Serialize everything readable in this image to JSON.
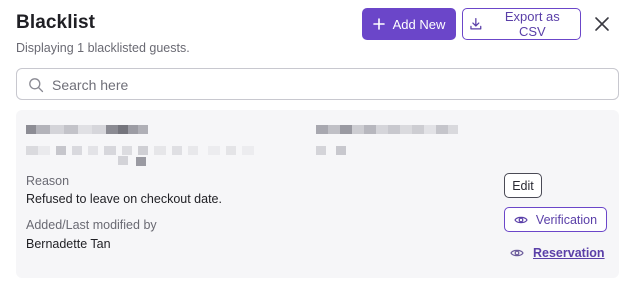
{
  "header": {
    "title": "Blacklist",
    "subtitle": "Displaying 1 blacklisted guests.",
    "add_new_label": "Add New",
    "export_label": "Export as CSV",
    "close_icon": "close-icon"
  },
  "search": {
    "placeholder": "Search here",
    "value": ""
  },
  "entry": {
    "guest_name_redacted": "",
    "reason_label": "Reason",
    "reason_value": "Refused to leave on checkout date.",
    "modified_label": "Added/Last modified by",
    "modified_value": "Bernadette Tan",
    "edit_label": "Edit",
    "verification_label": "Verification",
    "reservation_label": "Reservation"
  },
  "colors": {
    "accent": "#6b46c9",
    "card_bg": "#f6f6f8",
    "text": "#1f1f24",
    "muted": "#6a6a73"
  }
}
